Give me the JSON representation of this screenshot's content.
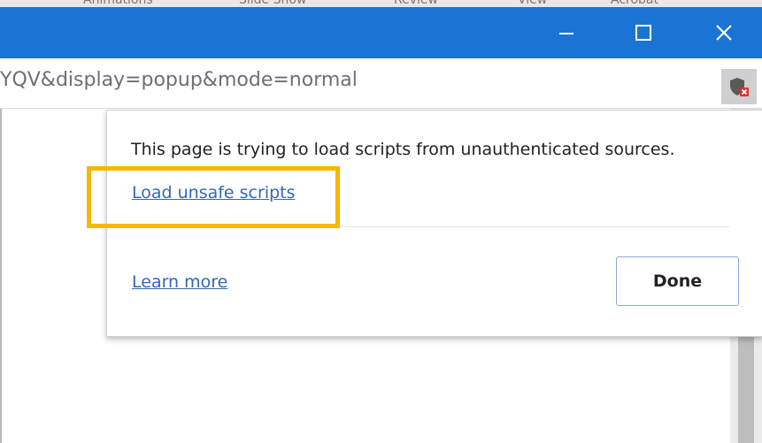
{
  "window": {
    "top_strip_items": [
      "Animations",
      "Slide Show",
      "Review",
      "View",
      "Acrobat"
    ],
    "controls": {
      "minimize_icon": "minimize-icon",
      "maximize_icon": "maximize-icon",
      "close_icon": "close-icon"
    },
    "titlebar_color": "#1b74d4"
  },
  "addressbar": {
    "url_text": "YQV&display=popup&mode=normal",
    "shield_icon": "blocked-content-shield-icon"
  },
  "popup": {
    "message": "This page is trying to load scripts from unauthenticated sources.",
    "load_link": "Load unsafe scripts",
    "learn_more": "Learn more",
    "done_label": "Done"
  },
  "highlight": {
    "color": "#f6b800",
    "target": "Load unsafe scripts"
  }
}
